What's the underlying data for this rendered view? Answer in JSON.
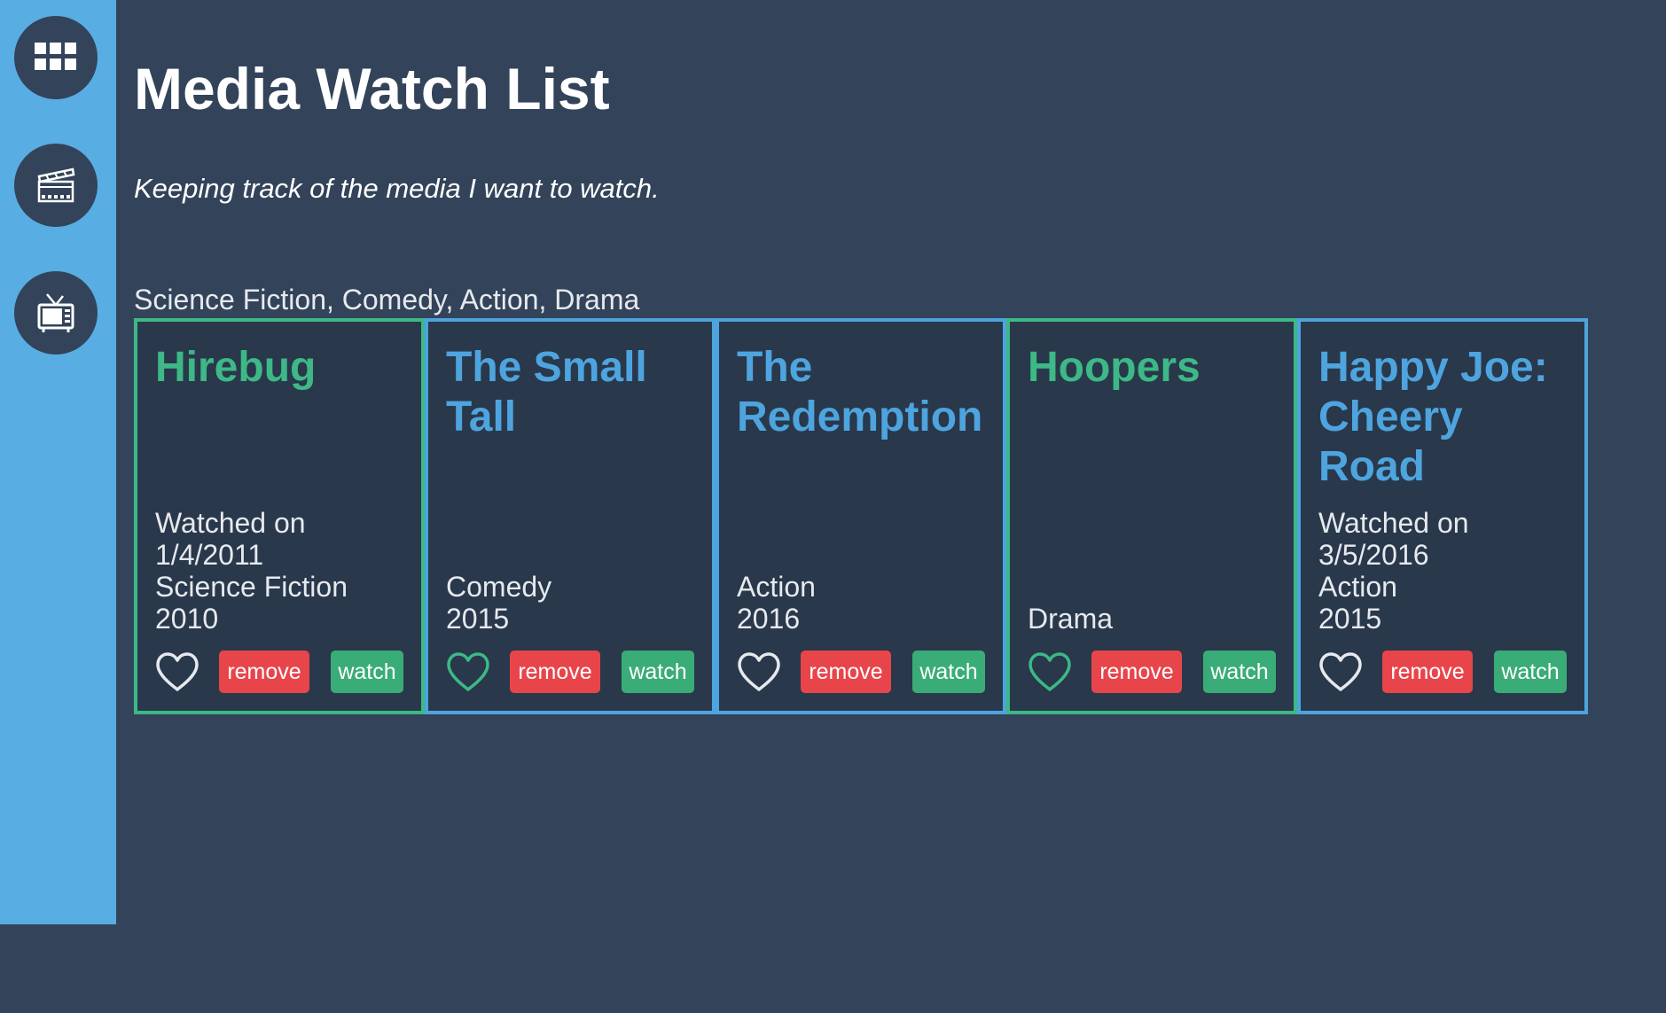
{
  "header": {
    "title": "Media Watch List",
    "subtitle": "Keeping track of the media I want to watch."
  },
  "sidebar": {
    "items": [
      {
        "icon": "grid-icon"
      },
      {
        "icon": "film-icon"
      },
      {
        "icon": "tv-icon"
      }
    ]
  },
  "genres": "Science Fiction, Comedy, Action, Drama",
  "colors": {
    "sidebar": "#58ade3",
    "background": "#33435a",
    "card_background": "#29384b",
    "watched": "#3db886",
    "unwatched": "#4ea4de",
    "remove": "#e8454b",
    "watch": "#3aac78"
  },
  "cards": [
    {
      "title": "Hirebug",
      "status": "watched",
      "watched_label": "Watched on",
      "watched_date": "1/4/2011",
      "genre": "Science Fiction",
      "year": "2010",
      "heart_color": "#e6e9ee",
      "remove_label": "remove",
      "watch_label": "watch"
    },
    {
      "title": "The Small Tall",
      "status": "unwatched",
      "watched_label": "",
      "watched_date": "",
      "genre": "Comedy",
      "year": "2015",
      "heart_color": "#3db886",
      "remove_label": "remove",
      "watch_label": "watch"
    },
    {
      "title": "The Redemption",
      "status": "unwatched",
      "watched_label": "",
      "watched_date": "",
      "genre": "Action",
      "year": "2016",
      "heart_color": "#e6e9ee",
      "remove_label": "remove",
      "watch_label": "watch"
    },
    {
      "title": "Hoopers",
      "status": "watched",
      "watched_label": "",
      "watched_date": "",
      "genre": "Drama",
      "year": "",
      "heart_color": "#3db886",
      "remove_label": "remove",
      "watch_label": "watch"
    },
    {
      "title": "Happy Joe: Cheery Road",
      "status": "unwatched",
      "watched_label": "Watched on",
      "watched_date": "3/5/2016",
      "genre": "Action",
      "year": "2015",
      "heart_color": "#e6e9ee",
      "remove_label": "remove",
      "watch_label": "watch"
    }
  ]
}
